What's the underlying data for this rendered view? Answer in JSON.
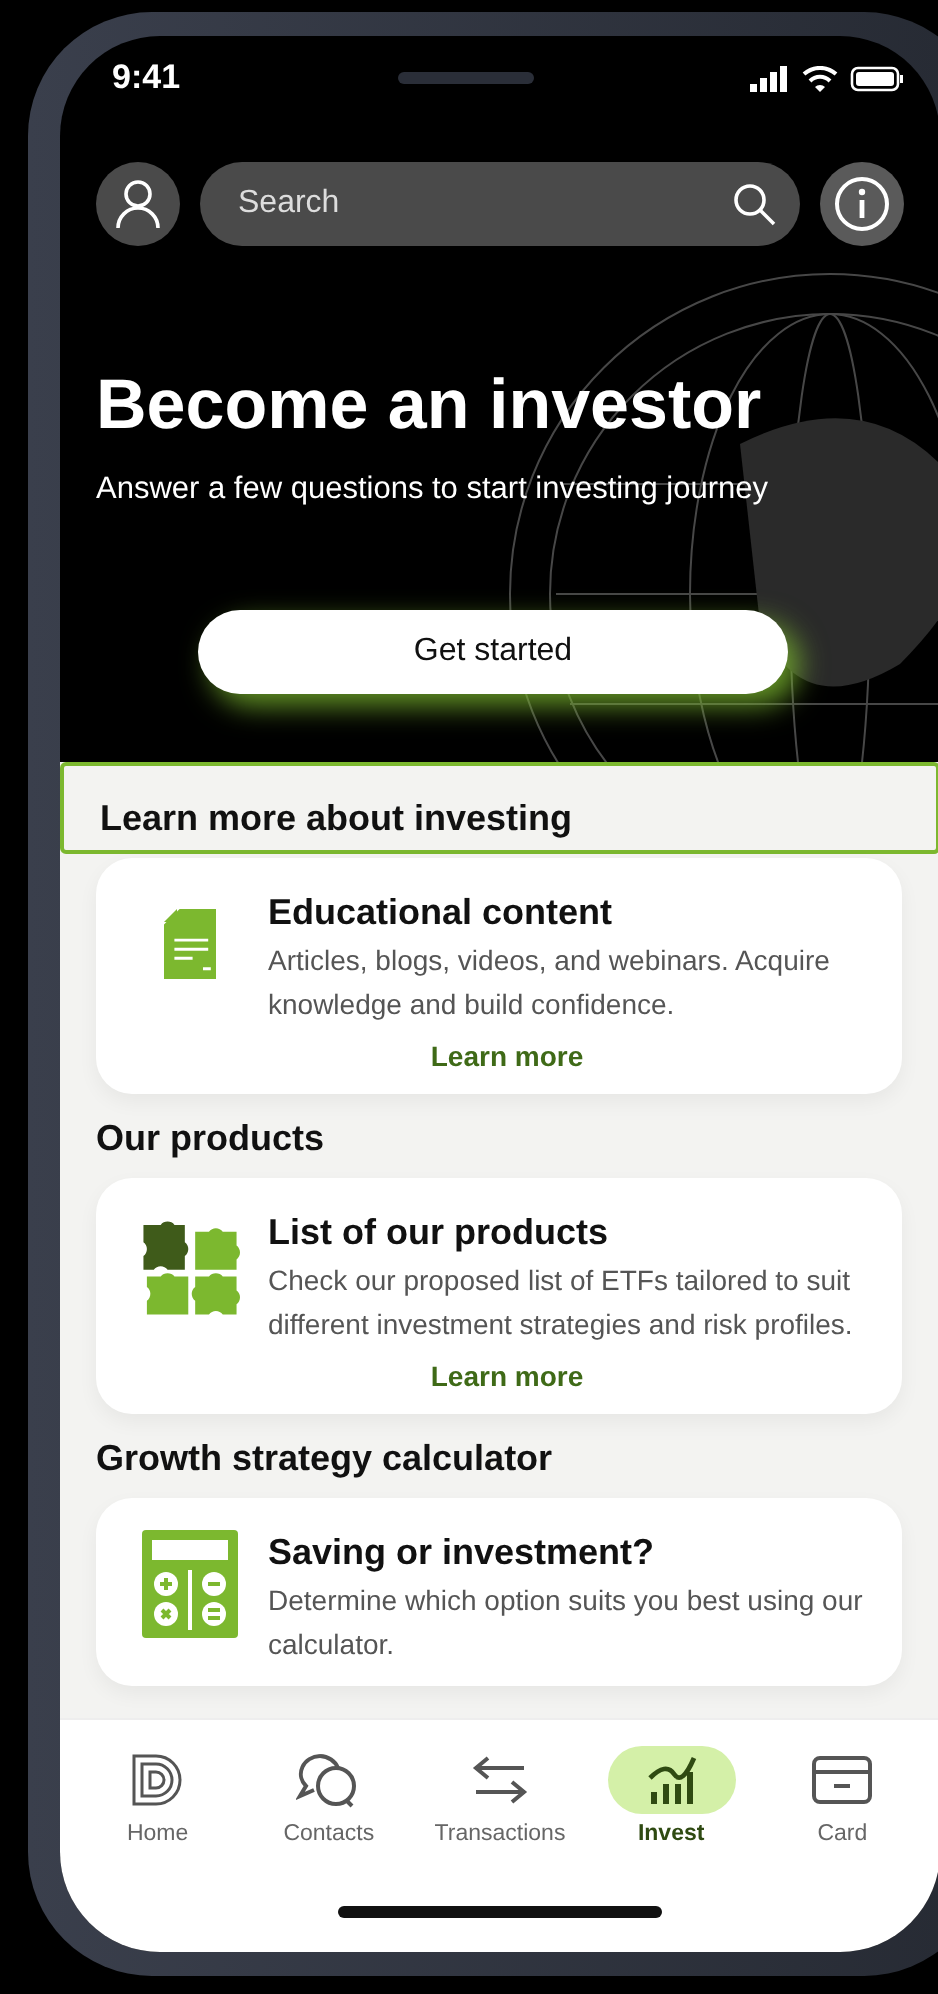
{
  "status_bar": {
    "time": "9:41"
  },
  "search": {
    "placeholder": "Search"
  },
  "hero": {
    "title": "Become an investor",
    "subtitle": "Answer a few questions to start investing journey",
    "button": "Get started"
  },
  "sections": [
    {
      "title": "Learn more about investing",
      "highlighted": true,
      "card": {
        "kind": "document",
        "title": "Educational content",
        "description": "Articles, blogs, videos, and webinars. Acquire knowledge and build confidence.",
        "link": "Learn more"
      }
    },
    {
      "title": "Our products",
      "highlighted": false,
      "card": {
        "kind": "puzzle",
        "title": "List of our products",
        "description": "Check our proposed list of ETFs tailored to suit different investment strategies and risk profiles.",
        "link": "Learn more"
      }
    },
    {
      "title": "Growth strategy calculator",
      "highlighted": false,
      "card": {
        "kind": "calculator",
        "title": "Saving or investment?",
        "description": "Determine which option suits you best using our calculator."
      }
    }
  ],
  "nav": [
    {
      "label": "Home",
      "kind": "home",
      "selected": false
    },
    {
      "label": "Contacts",
      "kind": "chat",
      "selected": false
    },
    {
      "label": "Transactions",
      "kind": "arrows",
      "selected": false
    },
    {
      "label": "Invest",
      "kind": "chart",
      "selected": true
    },
    {
      "label": "Card",
      "kind": "card",
      "selected": false
    }
  ]
}
